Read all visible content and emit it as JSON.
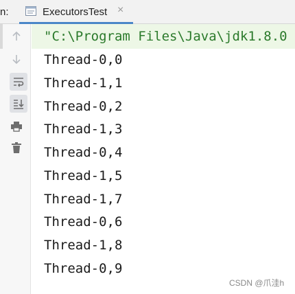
{
  "header": {
    "run_label": "n:",
    "tab_title": "ExecutorsTest",
    "tab_close": "×"
  },
  "sidebar": {
    "tools": [
      {
        "icon": "arrow-up-icon"
      },
      {
        "icon": "arrow-down-icon"
      },
      {
        "icon": "soft-wrap-icon"
      },
      {
        "icon": "scroll-to-end-icon"
      },
      {
        "icon": "print-icon"
      },
      {
        "icon": "trash-icon"
      }
    ]
  },
  "console": {
    "command": "\"C:\\Program Files\\Java\\jdk1.8.0",
    "lines": [
      "Thread-0,0",
      "Thread-1,1",
      "Thread-0,2",
      "Thread-1,3",
      "Thread-0,4",
      "Thread-1,5",
      "Thread-1,7",
      "Thread-0,6",
      "Thread-1,8",
      "Thread-0,9"
    ]
  },
  "watermark": "CSDN @爪洼h",
  "colors": {
    "tab_underline": "#4a86c8",
    "command_bg": "#edf7e6",
    "command_text": "#2b7a2b"
  }
}
